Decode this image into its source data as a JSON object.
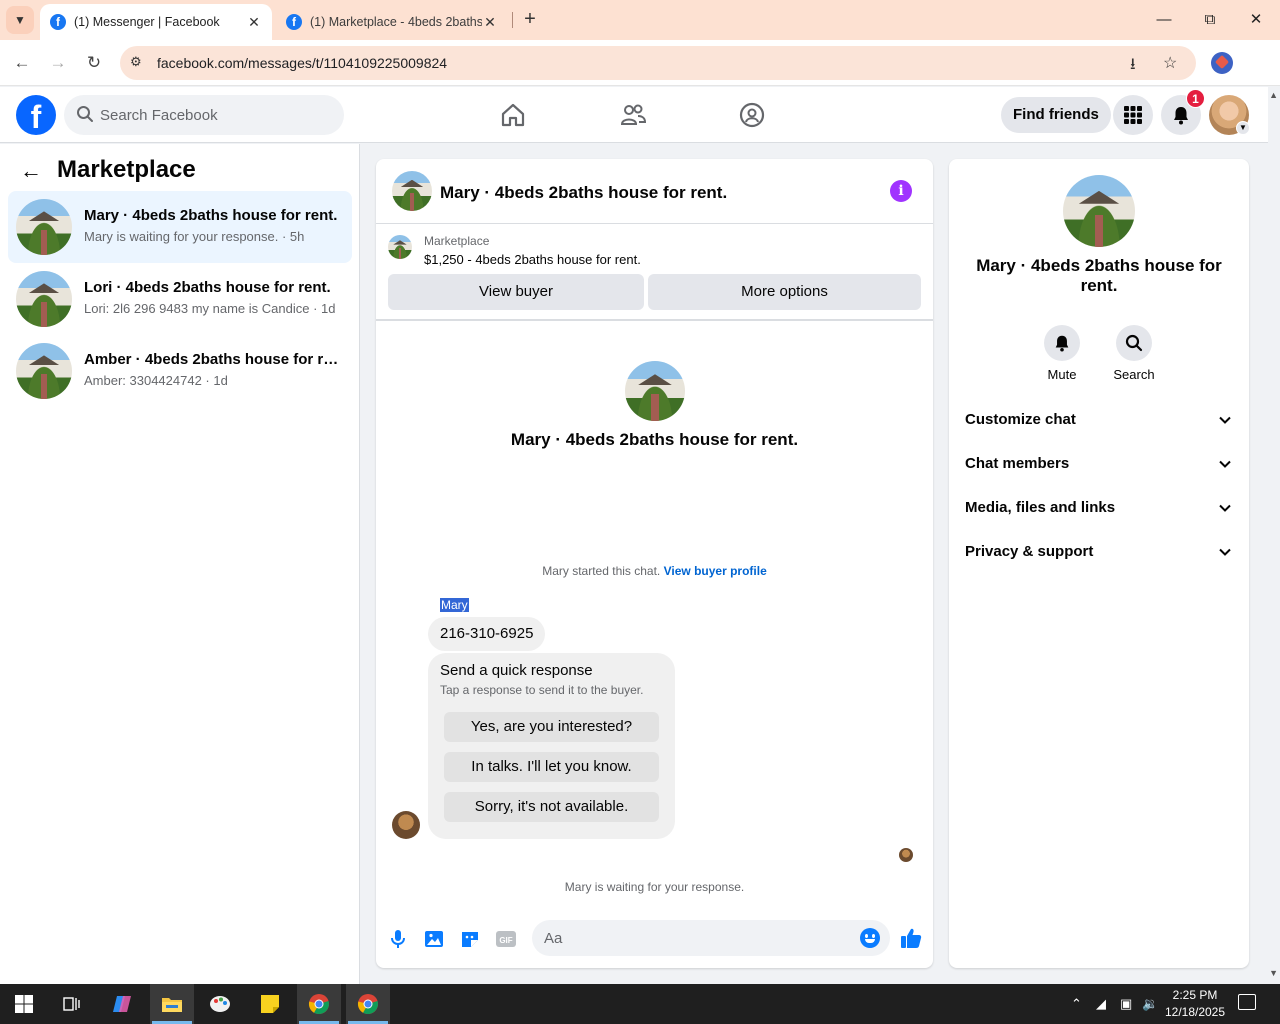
{
  "browser": {
    "tabs": [
      {
        "title": "(1) Messenger | Facebook",
        "active": true
      },
      {
        "title": "(1) Marketplace - 4beds 2baths",
        "active": false
      }
    ],
    "url": "facebook.com/messages/t/1104109225009824"
  },
  "fbnav": {
    "search_placeholder": "Search Facebook",
    "find_friends": "Find friends",
    "notification_count": "1"
  },
  "sidebar": {
    "title": "Marketplace",
    "conversations": [
      {
        "name": "Mary · 4beds 2baths house for rent.",
        "preview": "Mary is waiting for your response. · 5h",
        "selected": true
      },
      {
        "name": "Lori · 4beds 2baths house for rent.",
        "preview": "Lori: 2l6 296 9483 my name is Candice · 1d",
        "selected": false
      },
      {
        "name": "Amber · 4beds 2baths house for re...",
        "preview": "Amber: 3304424742 · 1d",
        "selected": false
      }
    ]
  },
  "chat": {
    "header_title": "Mary · 4beds 2baths house for rent.",
    "marketplace_label": "Marketplace",
    "listing": "$1,250 - 4beds 2baths house for rent.",
    "view_buyer": "View buyer",
    "more_options": "More options",
    "center_title": "Mary · 4beds 2baths house for rent.",
    "started_text": "Mary started this chat.",
    "view_buyer_profile": "View buyer profile",
    "sender_name": "Mary",
    "message": "216-310-6925",
    "quick_response": {
      "title": "Send a quick response",
      "subtitle": "Tap a response to send it to the buyer.",
      "options": [
        "Yes, are you interested?",
        "In talks. I'll let you know.",
        "Sorry, it's not available."
      ]
    },
    "waiting_text": "Mary is waiting for your response.",
    "composer_placeholder": "Aa"
  },
  "info_panel": {
    "title": "Mary · 4beds 2baths house for rent.",
    "actions": [
      {
        "label": "Mute",
        "icon": "bell-icon"
      },
      {
        "label": "Search",
        "icon": "search-icon"
      }
    ],
    "sections": [
      "Customize chat",
      "Chat members",
      "Media, files and links",
      "Privacy & support"
    ]
  },
  "taskbar": {
    "time": "2:25 PM",
    "date": "12/18/2025"
  },
  "colors": {
    "brand": "#0866ff",
    "link": "#0064d1",
    "accent_info": "#a033ff",
    "selected_bg": "#ebf5ff",
    "badge": "#e41e3f"
  }
}
